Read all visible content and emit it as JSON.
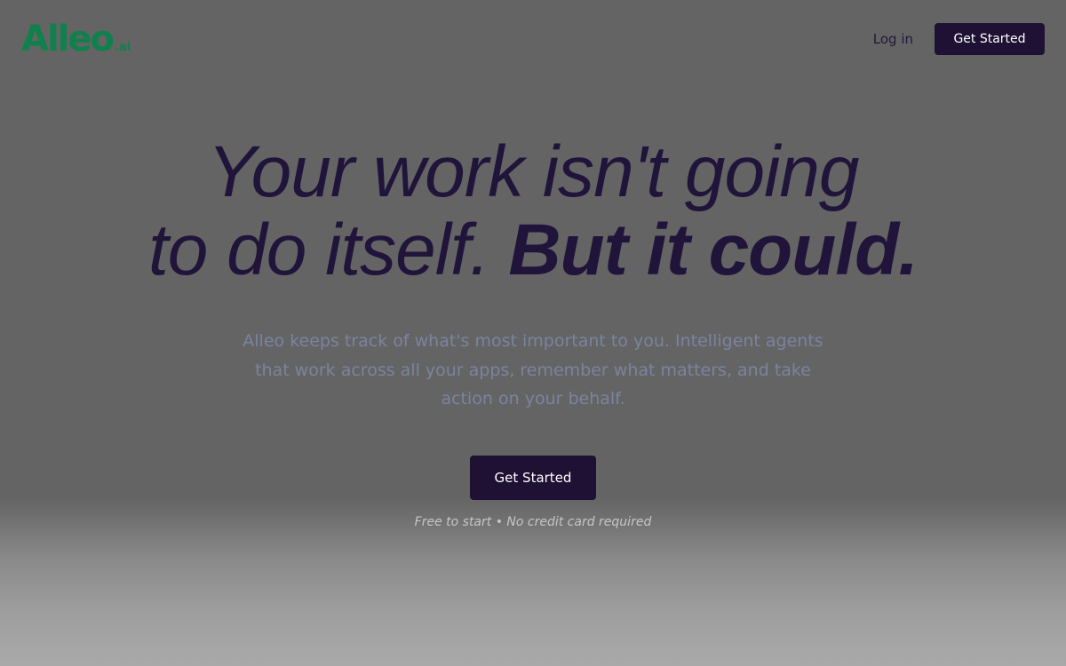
{
  "brand": {
    "name": "Alleo",
    "suffix": ".ai",
    "color": "#10804c"
  },
  "nav": {
    "login_label": "Log in",
    "cta_label": "Get Started"
  },
  "hero": {
    "headline_line1": "Your work isn't going",
    "headline_line2_light": "to do itself.",
    "headline_line2_bold": "But it could.",
    "subtext": "Alleo keeps track of what's most important to you. Intelligent agents that work across all your apps, remember what matters, and take action on your behalf.",
    "cta_label": "Get Started",
    "fineprint": "Free to start • No credit card required"
  },
  "colors": {
    "button_bg": "#1e1133",
    "headline": "#20143a",
    "subtext": "#7a84a0"
  }
}
